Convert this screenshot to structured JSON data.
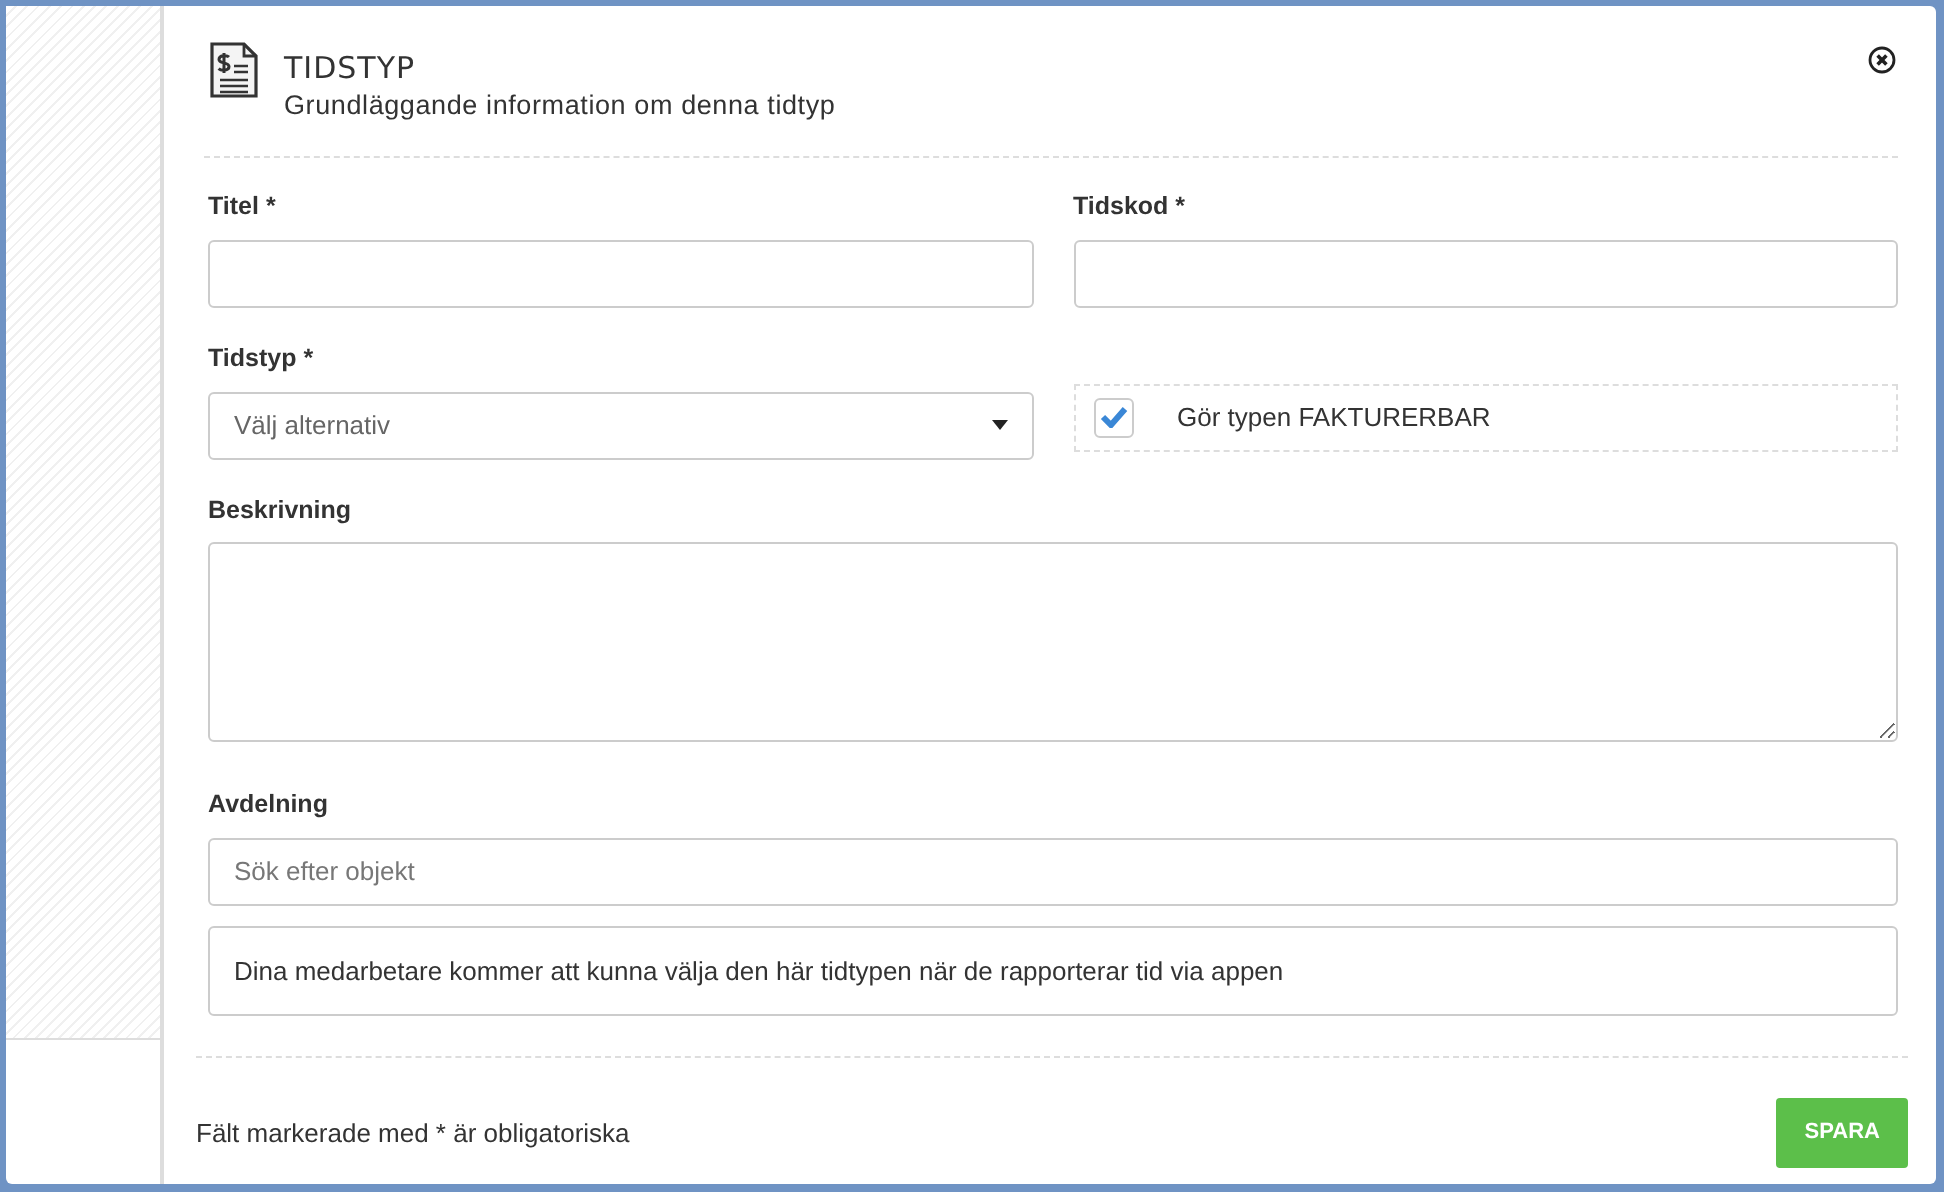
{
  "dialog": {
    "title": "TIDSTYP",
    "subtitle": "Grundläggande information om denna tidtyp"
  },
  "fields": [
    {
      "kind": "text",
      "label": "Titel *"
    },
    {
      "kind": "text",
      "label": "Tidskod *"
    },
    {
      "kind": "select",
      "label": "Tidstyp *",
      "placeholder": "Välj alternativ"
    },
    {
      "kind": "checkbox",
      "label": "Gör typen FAKTURERBAR",
      "checked": true
    },
    {
      "kind": "textarea",
      "label": "Beskrivning"
    },
    {
      "kind": "search",
      "label": "Avdelning",
      "placeholder": "Sök efter objekt"
    }
  ],
  "info": "Dina medarbetare kommer att kunna välja den här tidtypen när de rapporterar tid via appen",
  "footer": {
    "note": "Fält markerade med * är obligatoriska",
    "save_button": "SPARA"
  }
}
